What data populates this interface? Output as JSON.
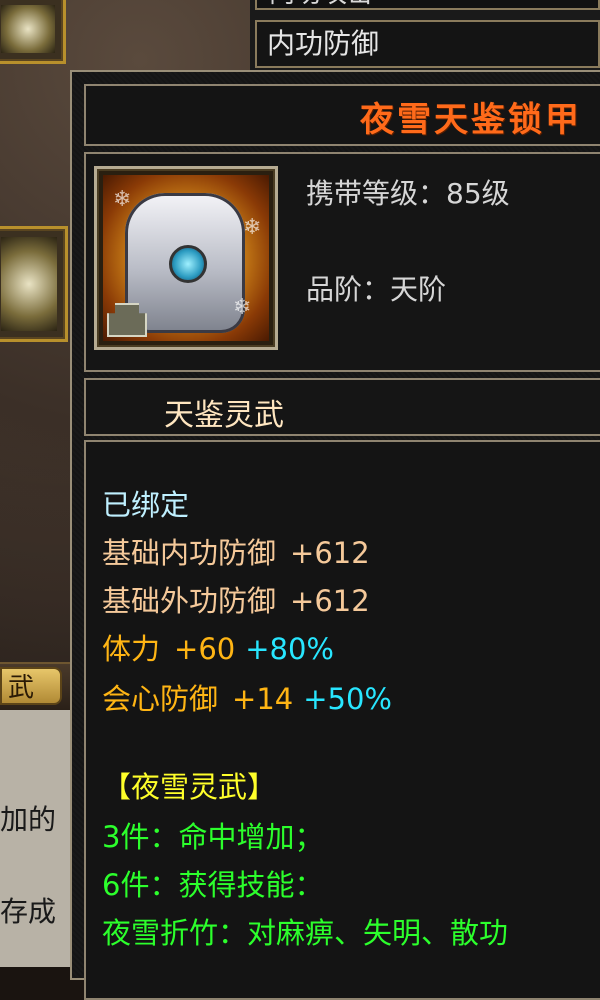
{
  "background": {
    "header_top": "内功攻击",
    "header_second": "内功防御",
    "tab_label": "武",
    "side_text_1": "加的",
    "side_text_2": "存成"
  },
  "item": {
    "name": "夜雪天鉴锁甲",
    "required_level": "携带等级：85级",
    "grade": "品阶：天阶",
    "set_series": "天鉴灵武",
    "bound": "已绑定",
    "stats": [
      {
        "label": "基础内功防御",
        "value": "+612"
      },
      {
        "label": "基础外功防御",
        "value": "+612"
      },
      {
        "label": "体力",
        "value": "+60",
        "percent": "+80%"
      },
      {
        "label": "会心防御",
        "value": "+14",
        "percent": "+50%"
      }
    ],
    "set_title": "【夜雪灵武】",
    "set_bonuses": [
      "3件：命中增加；",
      "6件：获得技能：",
      "夜雪折竹：对麻痹、失明、散功"
    ]
  },
  "colors": {
    "title": "#ff6a1a",
    "base_stat": "#f5c99a",
    "attr_stat": "#ffb514",
    "percent": "#28e6ff",
    "set_title": "#ffff2a",
    "set_bonus": "#2cff2c",
    "bound": "#bff0ff"
  },
  "icons": {
    "item_icon": "armor-icon",
    "bind_icon": "bind-lock-icon"
  }
}
